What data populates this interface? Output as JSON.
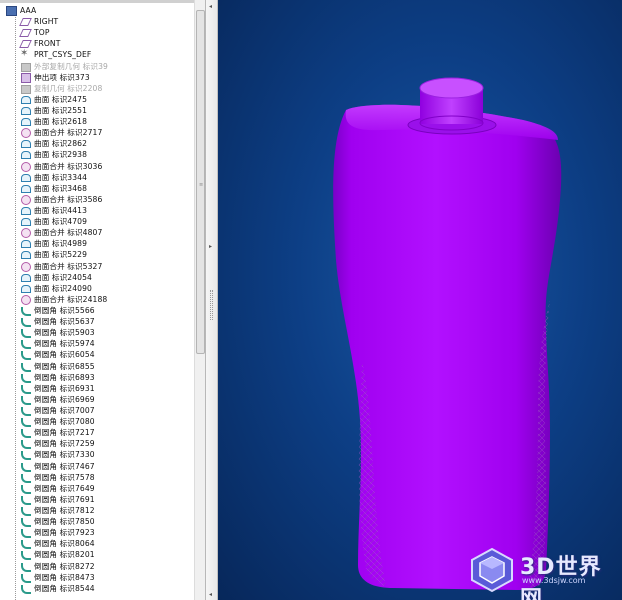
{
  "model_tree": {
    "root_label": "AAA",
    "items": [
      {
        "label": "RIGHT",
        "icon": "datum-plane-icon"
      },
      {
        "label": "TOP",
        "icon": "datum-plane-icon"
      },
      {
        "label": "FRONT",
        "icon": "datum-plane-icon"
      },
      {
        "label": "PRT_CSYS_DEF",
        "icon": "csys-icon"
      },
      {
        "label": "外部复制几何 标识39",
        "icon": "external-copy-geometry-icon",
        "suppressed": true
      },
      {
        "label": "伸出项 标识373",
        "icon": "extrude-icon"
      },
      {
        "label": "复制几何 标识2208",
        "icon": "copy-geometry-icon",
        "suppressed": true
      },
      {
        "label": "曲面 标识2475",
        "icon": "surface-icon"
      },
      {
        "label": "曲面 标识2551",
        "icon": "surface-icon"
      },
      {
        "label": "曲面 标识2618",
        "icon": "surface-icon"
      },
      {
        "label": "曲面合并 标识2717",
        "icon": "merge-icon"
      },
      {
        "label": "曲面 标识2862",
        "icon": "surface-icon"
      },
      {
        "label": "曲面 标识2938",
        "icon": "surface-icon"
      },
      {
        "label": "曲面合并 标识3036",
        "icon": "merge-icon"
      },
      {
        "label": "曲面 标识3344",
        "icon": "surface-icon"
      },
      {
        "label": "曲面 标识3468",
        "icon": "surface-icon"
      },
      {
        "label": "曲面合并 标识3586",
        "icon": "merge-icon"
      },
      {
        "label": "曲面 标识4413",
        "icon": "surface-icon"
      },
      {
        "label": "曲面 标识4709",
        "icon": "surface-icon"
      },
      {
        "label": "曲面合并 标识4807",
        "icon": "merge-icon"
      },
      {
        "label": "曲面 标识4989",
        "icon": "surface-icon"
      },
      {
        "label": "曲面 标识5229",
        "icon": "surface-icon"
      },
      {
        "label": "曲面合并 标识5327",
        "icon": "merge-icon"
      },
      {
        "label": "曲面 标识24054",
        "icon": "surface-icon"
      },
      {
        "label": "曲面 标识24090",
        "icon": "surface-icon"
      },
      {
        "label": "曲面合并 标识24188",
        "icon": "merge-icon"
      },
      {
        "label": "倒圆角 标识5566",
        "icon": "round-icon"
      },
      {
        "label": "倒圆角 标识5637",
        "icon": "round-icon"
      },
      {
        "label": "倒圆角 标识5903",
        "icon": "round-icon"
      },
      {
        "label": "倒圆角 标识5974",
        "icon": "round-icon"
      },
      {
        "label": "倒圆角 标识6054",
        "icon": "round-icon"
      },
      {
        "label": "倒圆角 标识6855",
        "icon": "round-icon"
      },
      {
        "label": "倒圆角 标识6893",
        "icon": "round-icon"
      },
      {
        "label": "倒圆角 标识6931",
        "icon": "round-icon"
      },
      {
        "label": "倒圆角 标识6969",
        "icon": "round-icon"
      },
      {
        "label": "倒圆角 标识7007",
        "icon": "round-icon"
      },
      {
        "label": "倒圆角 标识7080",
        "icon": "round-icon"
      },
      {
        "label": "倒圆角 标识7217",
        "icon": "round-icon"
      },
      {
        "label": "倒圆角 标识7259",
        "icon": "round-icon"
      },
      {
        "label": "倒圆角 标识7330",
        "icon": "round-icon"
      },
      {
        "label": "倒圆角 标识7467",
        "icon": "round-icon"
      },
      {
        "label": "倒圆角 标识7578",
        "icon": "round-icon"
      },
      {
        "label": "倒圆角 标识7649",
        "icon": "round-icon"
      },
      {
        "label": "倒圆角 标识7691",
        "icon": "round-icon"
      },
      {
        "label": "倒圆角 标识7812",
        "icon": "round-icon"
      },
      {
        "label": "倒圆角 标识7850",
        "icon": "round-icon"
      },
      {
        "label": "倒圆角 标识7923",
        "icon": "round-icon"
      },
      {
        "label": "倒圆角 标识8064",
        "icon": "round-icon"
      },
      {
        "label": "倒圆角 标识8201",
        "icon": "round-icon"
      },
      {
        "label": "倒圆角 标识8272",
        "icon": "round-icon"
      },
      {
        "label": "倒圆角 标识8473",
        "icon": "round-icon"
      },
      {
        "label": "倒圆角 标识8544",
        "icon": "round-icon"
      }
    ]
  },
  "viewport": {
    "background_color": "#0d3f86",
    "model_color": "#a000ff"
  },
  "watermark": {
    "brand": "3D世界网",
    "url": "www.3dsjw.com"
  }
}
